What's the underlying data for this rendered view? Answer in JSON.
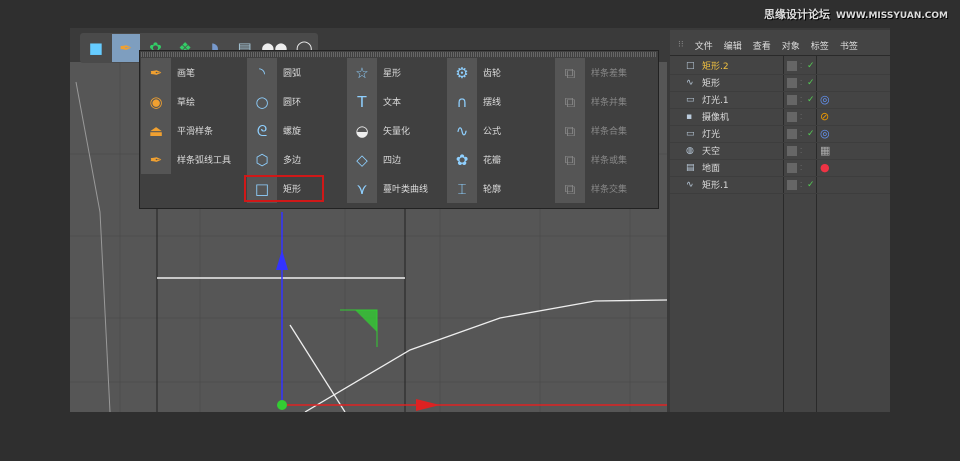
{
  "watermark": {
    "cn": "思缘设计论坛",
    "url": "WWW.MISSYUAN.COM"
  },
  "toolbar": {
    "icons": [
      "cube-icon",
      "pen-spline-icon",
      "generator-icon",
      "array-icon",
      "deformer-icon",
      "floor-grid-icon",
      "camera-icon",
      "light-icon"
    ]
  },
  "popup": {
    "columns": [
      {
        "items": [
          {
            "label": "画笔",
            "icon": "pen-icon"
          },
          {
            "label": "草绘",
            "icon": "sketch-icon"
          },
          {
            "label": "平滑样条",
            "icon": "smooth-spline-icon"
          },
          {
            "label": "样条弧线工具",
            "icon": "spline-arc-tool-icon"
          }
        ]
      },
      {
        "items": [
          {
            "label": "圆弧",
            "icon": "arc-icon"
          },
          {
            "label": "圆环",
            "icon": "circle-icon"
          },
          {
            "label": "螺旋",
            "icon": "helix-icon"
          },
          {
            "label": "多边",
            "icon": "polygon-icon"
          },
          {
            "label": "矩形",
            "icon": "rectangle-icon",
            "selected": true
          }
        ]
      },
      {
        "items": [
          {
            "label": "星形",
            "icon": "star-icon"
          },
          {
            "label": "文本",
            "icon": "text-icon"
          },
          {
            "label": "矢量化",
            "icon": "vectorizer-icon"
          },
          {
            "label": "四边",
            "icon": "4-side-icon"
          },
          {
            "label": "蔓叶类曲线",
            "icon": "cissoid-icon"
          }
        ]
      },
      {
        "items": [
          {
            "label": "齿轮",
            "icon": "cogwheel-icon"
          },
          {
            "label": "摆线",
            "icon": "cycloid-icon"
          },
          {
            "label": "公式",
            "icon": "formula-icon"
          },
          {
            "label": "花瓣",
            "icon": "flower-icon"
          },
          {
            "label": "轮廓",
            "icon": "profile-icon"
          }
        ]
      },
      {
        "items": [
          {
            "label": "样条差集",
            "icon": "spline-subtract-icon"
          },
          {
            "label": "样条并集",
            "icon": "spline-union-icon"
          },
          {
            "label": "样条合集",
            "icon": "spline-and-icon"
          },
          {
            "label": "样条或集",
            "icon": "spline-or-icon"
          },
          {
            "label": "样条交集",
            "icon": "spline-intersect-icon"
          }
        ]
      }
    ]
  },
  "object_manager": {
    "menu": [
      "文件",
      "编辑",
      "查看",
      "对象",
      "标签",
      "书签"
    ],
    "objects": [
      {
        "name": "矩形.2",
        "icon": "rectangle-icon",
        "highlighted": true,
        "check": true,
        "tag": ""
      },
      {
        "name": "矩形",
        "icon": "spline-icon",
        "check": true,
        "tag": ""
      },
      {
        "name": "灯光.1",
        "icon": "light-icon",
        "check": true,
        "tag": "target-tag-icon"
      },
      {
        "name": "摄像机",
        "icon": "camera-icon",
        "check": false,
        "tag": "protection-tag-icon"
      },
      {
        "name": "灯光",
        "icon": "light-icon",
        "check": true,
        "tag": "target-tag-icon"
      },
      {
        "name": "天空",
        "icon": "sky-icon",
        "check": false,
        "tag": "material-tag-icon"
      },
      {
        "name": "地面",
        "icon": "floor-icon",
        "check": false,
        "tag": "material-tag-icon"
      },
      {
        "name": "矩形.1",
        "icon": "spline-icon",
        "check": true,
        "tag": ""
      }
    ]
  },
  "colors": {
    "selection": "#d01818",
    "accent_blue": "#8fd0ff",
    "highlight": "#f0c040"
  }
}
